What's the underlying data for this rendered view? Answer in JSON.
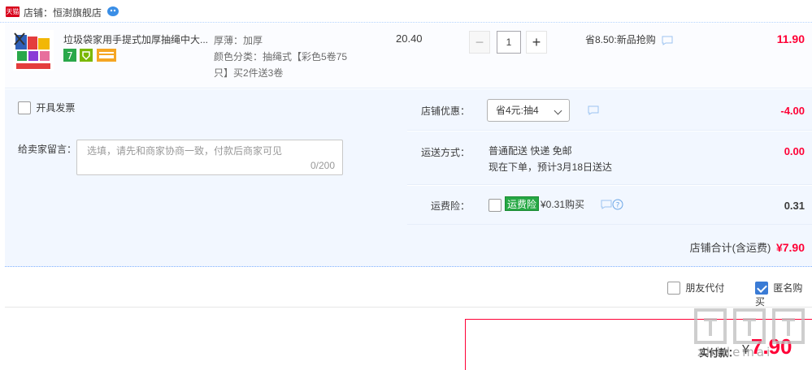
{
  "shop": {
    "badge": "天猫",
    "label": "店铺：恒澍旗舰店"
  },
  "item": {
    "title": "垃圾袋家用手提式加厚抽绳中大...",
    "sku_line1": "厚薄：加厚",
    "sku_line2": "颜色分类：抽绳式【彩色5卷75只】买2件送3卷",
    "unit_price": "20.40",
    "quantity": "1",
    "qty_minus": "−",
    "qty_plus": "+",
    "promo": "省8.50:新品抢购",
    "subtotal": "11.90"
  },
  "invoice": {
    "label": "开具发票"
  },
  "memo": {
    "label": "给卖家留言：",
    "placeholder": "选填，请先和商家协商一致，付款后商家可见",
    "count": "0/200"
  },
  "discount": {
    "label": "店铺优惠：",
    "selected": "省4元:抽4",
    "amount": "-4.00"
  },
  "shipping": {
    "label": "运送方式：",
    "method": "普通配送 快递 免邮",
    "eta": "现在下单，预计3月18日送达",
    "amount": "0.00"
  },
  "insurance": {
    "label": "运费险：",
    "badge": "运费险",
    "price": "¥0.31购买",
    "amount": "0.31"
  },
  "shop_total": {
    "label": "店铺合计(含运费)",
    "amount": "¥7.90"
  },
  "options": {
    "friend_pay": "朋友代付",
    "anonymous": "匿名购买"
  },
  "payment": {
    "label": "实付款：",
    "yen": "¥",
    "amount": "7.90"
  },
  "watermark": {
    "text": "zhidemai"
  },
  "colors": {
    "price_red": "#ff0036",
    "panel_blue": "#f2f7ff",
    "badge_green": "#26a844"
  }
}
